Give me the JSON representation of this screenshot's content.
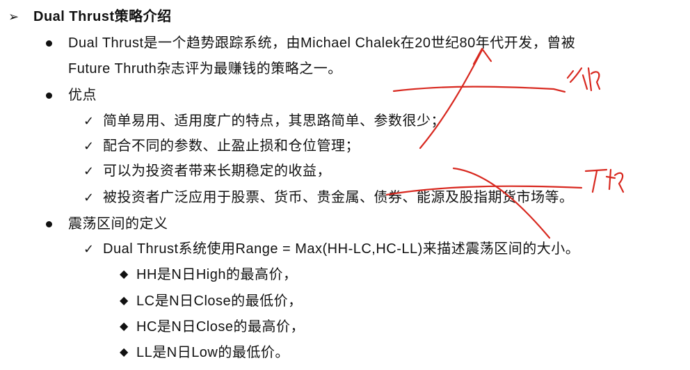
{
  "header": {
    "bullet": "➢",
    "title": "Dual Thrust策略介绍"
  },
  "intro": {
    "line1": "Dual Thrust是一个趋势跟踪系统，由Michael Chalek在20世纪80年代开发，曾被",
    "line2": "Future Thruth杂志评为最赚钱的策略之一。"
  },
  "advantages": {
    "heading": "优点",
    "items": [
      "简单易用、适用度广的特点，其思路简单、参数很少；",
      "配合不同的参数、止盈止损和仓位管理；",
      "可以为投资者带来长期稳定的收益，",
      "被投资者广泛应用于股票、货币、贵金属、债券、能源及股指期货市场等。"
    ]
  },
  "range": {
    "heading": "震荡区间的定义",
    "formula": "Dual Thrust系统使用Range = Max(HH-LC,HC-LL)来描述震荡区间的大小。",
    "defs": [
      "HH是N日High的最高价，",
      "LC是N日Close的最低价，",
      "HC是N日Close的最高价，",
      "LL是N日Low的最低价。"
    ]
  },
  "ink": {
    "color": "#d8281f"
  }
}
